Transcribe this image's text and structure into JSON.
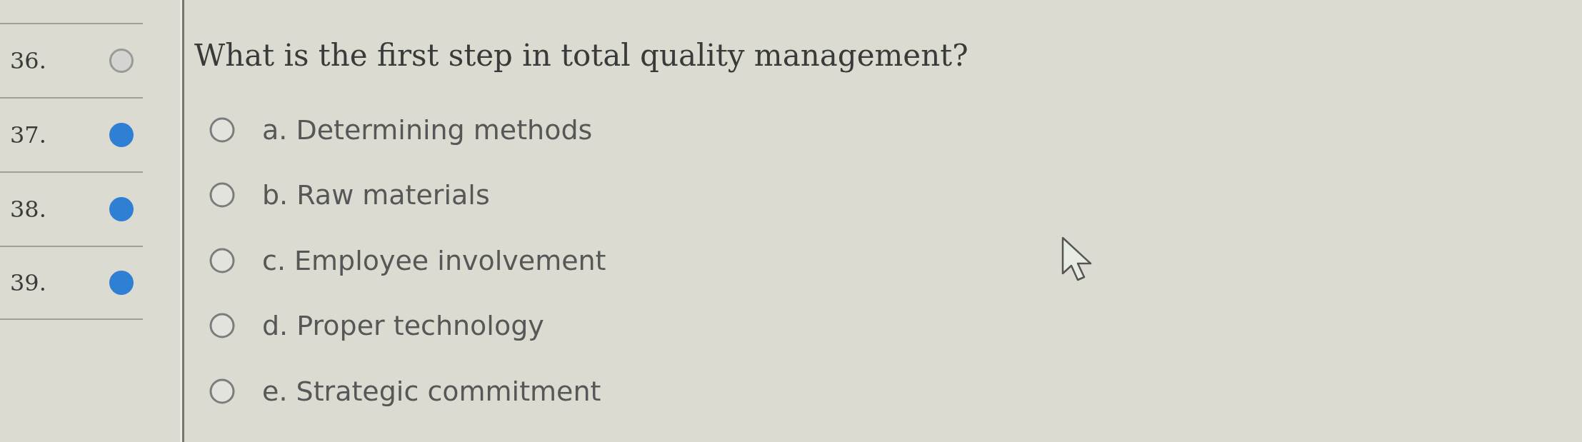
{
  "question_nav": [
    {
      "number": "36.",
      "answered": false
    },
    {
      "number": "37.",
      "answered": true
    },
    {
      "number": "38.",
      "answered": true
    },
    {
      "number": "39.",
      "answered": true
    }
  ],
  "question": {
    "text": "What is the first step in total quality management?",
    "options": [
      {
        "label": "a. Determining methods",
        "selected": false
      },
      {
        "label": "b. Raw materials",
        "selected": false
      },
      {
        "label": "c. Employee involvement",
        "selected": false
      },
      {
        "label": "d. Proper technology",
        "selected": false
      },
      {
        "label": "e. Strategic commitment",
        "selected": false
      }
    ]
  }
}
